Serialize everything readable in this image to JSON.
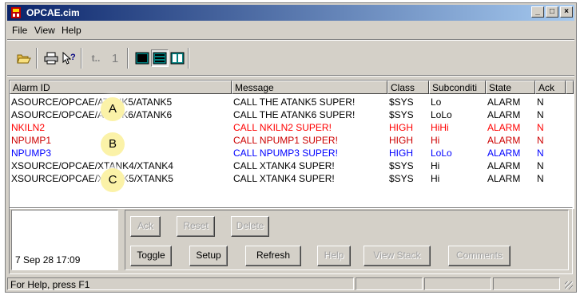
{
  "window": {
    "title": "OPCAE.cim"
  },
  "menu": {
    "file": "File",
    "view": "View",
    "help": "Help"
  },
  "toolbar": {
    "icons": [
      "open-icon",
      "print-icon",
      "help-pointer-icon",
      "first-alarm-icon",
      "one-icon",
      "view-icon-1",
      "view-icon-2",
      "view-icon-3"
    ],
    "first_label": "t..",
    "one_label": "1"
  },
  "columns": [
    "Alarm ID",
    "Message",
    "Class",
    "Subconditi",
    "State",
    "Ack"
  ],
  "rows": [
    {
      "id": "ASOURCE/OPCAE/ATANK5/ATANK5",
      "message": "CALL THE ATANK5 SUPER!",
      "class": "$SYS",
      "subcondition": "Lo",
      "state": "ALARM",
      "ack": "N",
      "color": "#000000"
    },
    {
      "id": "ASOURCE/OPCAE/ATANK6/ATANK6",
      "message": "CALL THE ATANK6 SUPER!",
      "class": "$SYS",
      "subcondition": "LoLo",
      "state": "ALARM",
      "ack": "N",
      "color": "#000000"
    },
    {
      "id": "NKILN2",
      "message": "CALL NKILN2 SUPER!",
      "class": "HIGH",
      "subcondition": "HiHi",
      "state": "ALARM",
      "ack": "N",
      "color": "#ff0000"
    },
    {
      "id": "NPUMP1",
      "message": "CALL NPUMP1 SUPER!",
      "class": "HIGH",
      "subcondition": "Hi",
      "state": "ALARM",
      "ack": "N",
      "color": "#cc0000"
    },
    {
      "id": "NPUMP3",
      "message": "CALL NPUMP3 SUPER!",
      "class": "HIGH",
      "subcondition": "LoLo",
      "state": "ALARM",
      "ack": "N",
      "color": "#0000ff"
    },
    {
      "id": "XSOURCE/OPCAE/XTANK4/XTANK4",
      "message": "CALL XTANK4 SUPER!",
      "class": "$SYS",
      "subcondition": "Hi",
      "state": "ALARM",
      "ack": "N",
      "color": "#000000"
    },
    {
      "id": "XSOURCE/OPCAE/XTANK5/XTANK5",
      "message": "CALL XTANK4 SUPER!",
      "class": "$SYS",
      "subcondition": "Hi",
      "state": "ALARM",
      "ack": "N",
      "color": "#000000"
    }
  ],
  "callouts": [
    "A",
    "B",
    "C"
  ],
  "datetime": "7 Sep 28 17:09",
  "buttons": {
    "ack": "Ack",
    "reset": "Reset",
    "delete": "Delete",
    "toggle": "Toggle",
    "setup": "Setup",
    "refresh": "Refresh",
    "help": "Help",
    "view_stack": "View Stack",
    "comments": "Comments"
  },
  "status": {
    "text": "For Help, press F1"
  }
}
